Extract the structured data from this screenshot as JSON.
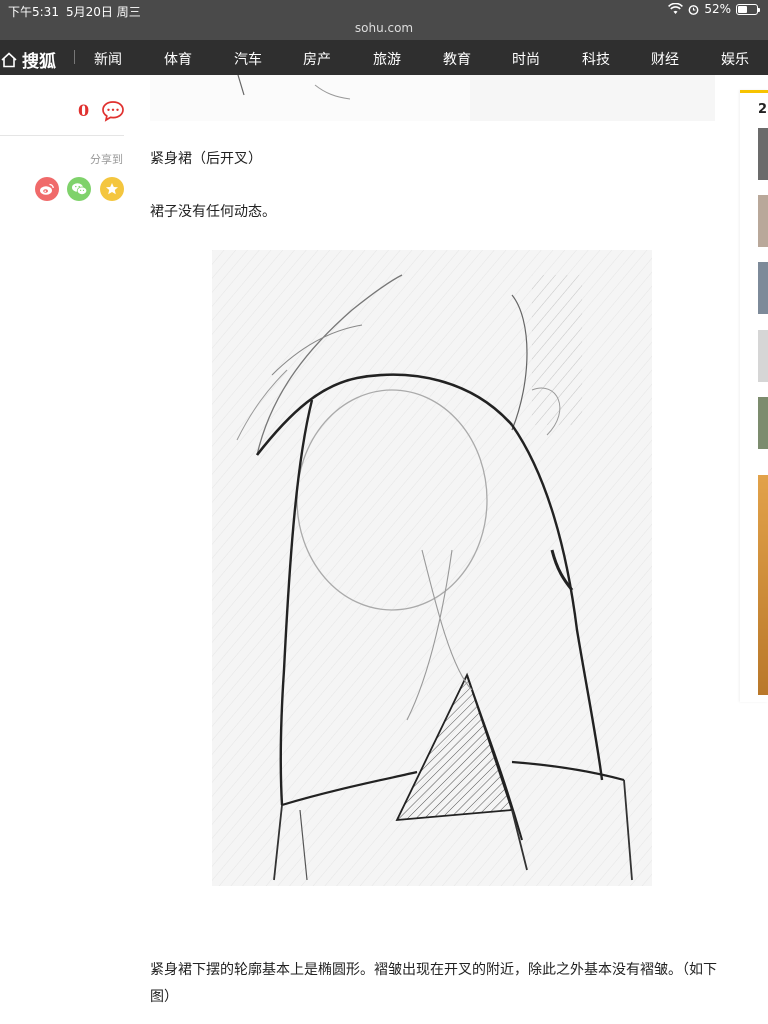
{
  "status_bar": {
    "time": "下午5:31",
    "date": "5月20日 周三",
    "battery": "52%",
    "battery_level": 0.52
  },
  "url": "sohu.com",
  "nav": {
    "logo": "搜狐",
    "items": [
      "新闻",
      "体育",
      "汽车",
      "房产",
      "旅游",
      "教育",
      "时尚",
      "科技",
      "财经",
      "娱乐"
    ]
  },
  "side": {
    "comment_count": "0",
    "share_label": "分享到"
  },
  "article": {
    "p1": "紧身裙（后开叉）",
    "p2": "裙子没有任何动态。",
    "p3": "紧身裙下摆的轮廓基本上是椭圆形。褶皱出现在开叉的附近，除此之外基本没有褶皱。（如下图）"
  },
  "right_panel": {
    "heading": "2"
  },
  "colors": {
    "nav_bg": "#2f2f2f",
    "status_bg": "#4a4a4a",
    "accent": "#f7c300",
    "comment_red": "#e0312f"
  }
}
